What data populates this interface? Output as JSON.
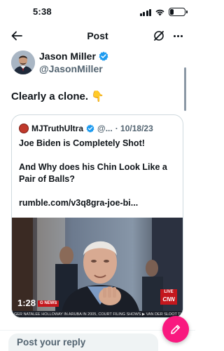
{
  "status_bar": {
    "time": "5:38",
    "battery": "24",
    "battery_level": 0.24
  },
  "nav": {
    "title": "Post",
    "back_icon": "arrow-left-icon",
    "grok_icon": "grok-icon",
    "more_icon": "more-horizontal-icon"
  },
  "author": {
    "name": "Jason Miller",
    "handle": "@JasonMiller",
    "verified": true
  },
  "post": {
    "text": "Clearly a clone. 👇"
  },
  "quote": {
    "name": "MJTruthUltra",
    "handle": "@...",
    "date": "· 10/18/23",
    "lines": [
      "Joe Biden is Completely Shot!",
      "And Why does his Chin Look Like a Pair of Balls?",
      "rumble.com/v3q8gra-joe-bi..."
    ],
    "media": {
      "time": "1:28",
      "tag": "G NEWS",
      "live": "LIVE",
      "network": "CNN",
      "ticker": "GER NATALEE HOLLOWAY IN ARUBA IN 2005, COURT FILING SHOWS  ▶ VAN DER SLOOT  THE LEAD"
    }
  },
  "reply": {
    "placeholder": "Post your reply"
  },
  "colors": {
    "accent_blue": "#1d9bf0",
    "fab_pink": "#f9197f",
    "muted": "#536471"
  }
}
